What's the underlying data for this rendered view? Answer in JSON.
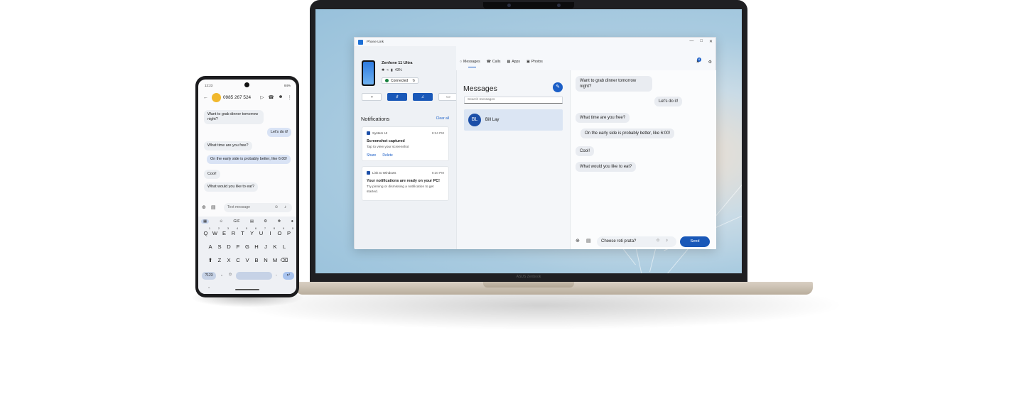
{
  "window": {
    "app_title": "Phone Link",
    "controls": [
      "—",
      "□",
      "✕"
    ]
  },
  "device": {
    "name": "Zenfone 11 Ultra",
    "battery": "43%",
    "status": "Connected"
  },
  "tabs": [
    {
      "icon": "○",
      "label": "Messages"
    },
    {
      "icon": "☎",
      "label": "Calls"
    },
    {
      "icon": "▦",
      "label": "Apps"
    },
    {
      "icon": "▣",
      "label": "Photos"
    }
  ],
  "bell_badge": "8",
  "notifications": {
    "header": "Notifications",
    "clear_all": "Clear all",
    "items": [
      {
        "source": "System UI",
        "time": "8:24 PM",
        "title": "Screenshot captured",
        "body": "Tap to view your screenshot",
        "actions": [
          "Share",
          "Delete"
        ]
      },
      {
        "source": "Link to Windows",
        "time": "8:20 PM",
        "title": "Your notifications are ready on your PC!",
        "body": "Try pinning or dismissing a notification to get started.",
        "actions": []
      }
    ]
  },
  "messages": {
    "title": "Messages",
    "search_placeholder": "Search messages",
    "conversations": [
      {
        "initials": "BL",
        "name": "Bill Lay"
      }
    ]
  },
  "chat": {
    "bubbles": [
      {
        "text": "Want to grab dinner tomorrow night?",
        "side": "in"
      },
      {
        "text": "Let's do it!",
        "side": "out"
      },
      {
        "text": "What time are you free?",
        "side": "in"
      },
      {
        "text": "On the early side is probably better, like 6:00!",
        "side": "out"
      },
      {
        "text": "Cool!",
        "side": "in"
      },
      {
        "text": "What would you like to eat?",
        "side": "in"
      }
    ],
    "compose_value": "Cheese roti prata?",
    "send_label": "Send"
  },
  "phone": {
    "status_time": "12:23",
    "status_battery": "84%",
    "contact_number": "0985 267 524",
    "compose_placeholder": "Text message",
    "keyboard": {
      "toolbar": [
        "▦",
        "☺",
        "GIF",
        "▤",
        "⚙",
        "❖",
        "●"
      ],
      "row1": [
        "Q",
        "W",
        "E",
        "R",
        "T",
        "Y",
        "U",
        "I",
        "O",
        "P"
      ],
      "row1_hints": [
        "1",
        "2",
        "3",
        "4",
        "5",
        "6",
        "7",
        "8",
        "9",
        "0"
      ],
      "row2": [
        "A",
        "S",
        "D",
        "F",
        "G",
        "H",
        "J",
        "K",
        "L"
      ],
      "row3": [
        "⬆",
        "Z",
        "X",
        "C",
        "V",
        "B",
        "N",
        "M",
        "⌫"
      ],
      "symbols_key": "?123",
      "comma": ",",
      "period": ".",
      "enter": "↵"
    }
  },
  "laptop_brand": "ASUS Zenbook",
  "colors": {
    "accent": "#1958b8",
    "link": "#1c5fc7",
    "bubble_in": "#e9ecf1"
  }
}
